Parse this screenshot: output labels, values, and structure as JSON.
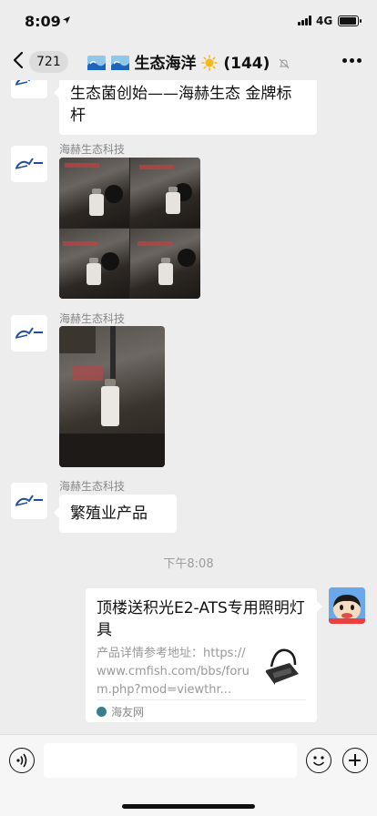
{
  "status_bar": {
    "time": "8:09",
    "location_icon": "location-arrow-icon",
    "signal_icon": "signal-bars-icon",
    "network": "4G",
    "battery_icon": "battery-icon",
    "battery_level": 0.85
  },
  "nav": {
    "back_icon": "chevron-left-icon",
    "unread_count": "721",
    "title_prefix_icon": "wave-emoji-icon",
    "title_text": "生态海洋",
    "title_suffix_icon": "sun-emoji-icon",
    "member_count": "(144)",
    "mute_icon": "bell-muted-icon",
    "more_icon": "ellipsis-icon"
  },
  "messages": [
    {
      "type": "text",
      "text": "生态菌创始——海赫生态    金牌标杆"
    },
    {
      "type": "image",
      "sender": "海赫生态科技",
      "content": "photo-grid-2x2"
    },
    {
      "type": "image",
      "sender": "海赫生态科技",
      "content": "photo-bottle"
    },
    {
      "type": "text",
      "sender": "海赫生态科技",
      "text": "繁殖业产品"
    }
  ],
  "timestamp": "下午8:08",
  "link_card": {
    "title": "顶楼送积光E2-ATS专用照明灯具",
    "description": "产品详情参考地址：https://www.cmfish.com/bbs/forum.php?mod=viewthr...",
    "source": "海友网",
    "source_icon": "site-logo-icon"
  },
  "input_bar": {
    "voice_icon": "voice-icon",
    "emoji_icon": "emoji-icon",
    "plus_icon": "plus-icon"
  },
  "colors": {
    "background": "#ededed",
    "bubble": "#ffffff",
    "secondary_text": "#888888"
  }
}
